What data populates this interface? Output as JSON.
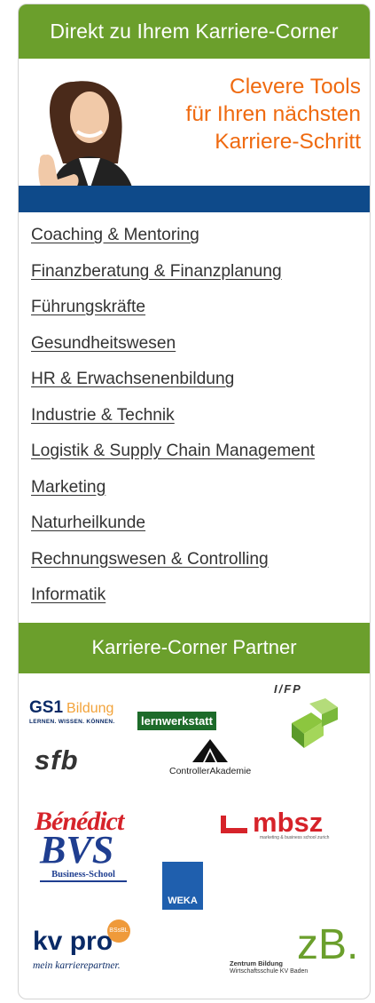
{
  "header": {
    "title": "Direkt zu Ihrem Karriere-Corner"
  },
  "banner": {
    "line1": "Clevere Tools",
    "line2": "für Ihren nächsten",
    "line3": "Karriere-Schritt"
  },
  "links": [
    "Coaching & Mentoring",
    "Finanzberatung & Finanzplanung",
    "Führungskräfte",
    "Gesundheitswesen",
    "HR & Erwachsenenbildung",
    "Industrie & Technik",
    "Logistik & Supply Chain Management",
    "Marketing",
    "Naturheilkunde",
    "Rechnungswesen & Controlling",
    "Informatik"
  ],
  "partners_header": {
    "title": "Karriere-Corner Partner"
  },
  "partners": {
    "gs1_title": "GS1",
    "gs1_bildung": "Bildung",
    "gs1_slogan": "LERNEN. WISSEN. KÖNNEN.",
    "lernwerkstatt": "lernwerkstatt",
    "ifp": "I/FP",
    "sfb": "sfb",
    "controller_akademie": "ControllerAkademie",
    "benedict": "Bénédict",
    "bvs": "BVS",
    "bvs_sub": "Business-School",
    "weka": "WEKA",
    "mbsz": "mbsz",
    "mbsz_sub": "marketing & business school zurich",
    "kvpro": "kv pro",
    "kvpro_badge": "BSsBL",
    "kvpro_sub": "mein karrierepartner.",
    "zb_big": "zB.",
    "zb_line1": "Zentrum Bildung",
    "zb_line2": "Wirtschaftsschule KV Baden"
  },
  "colors": {
    "green": "#6b9f2c",
    "orange": "#ef6a10",
    "blue": "#0e4a8a"
  }
}
